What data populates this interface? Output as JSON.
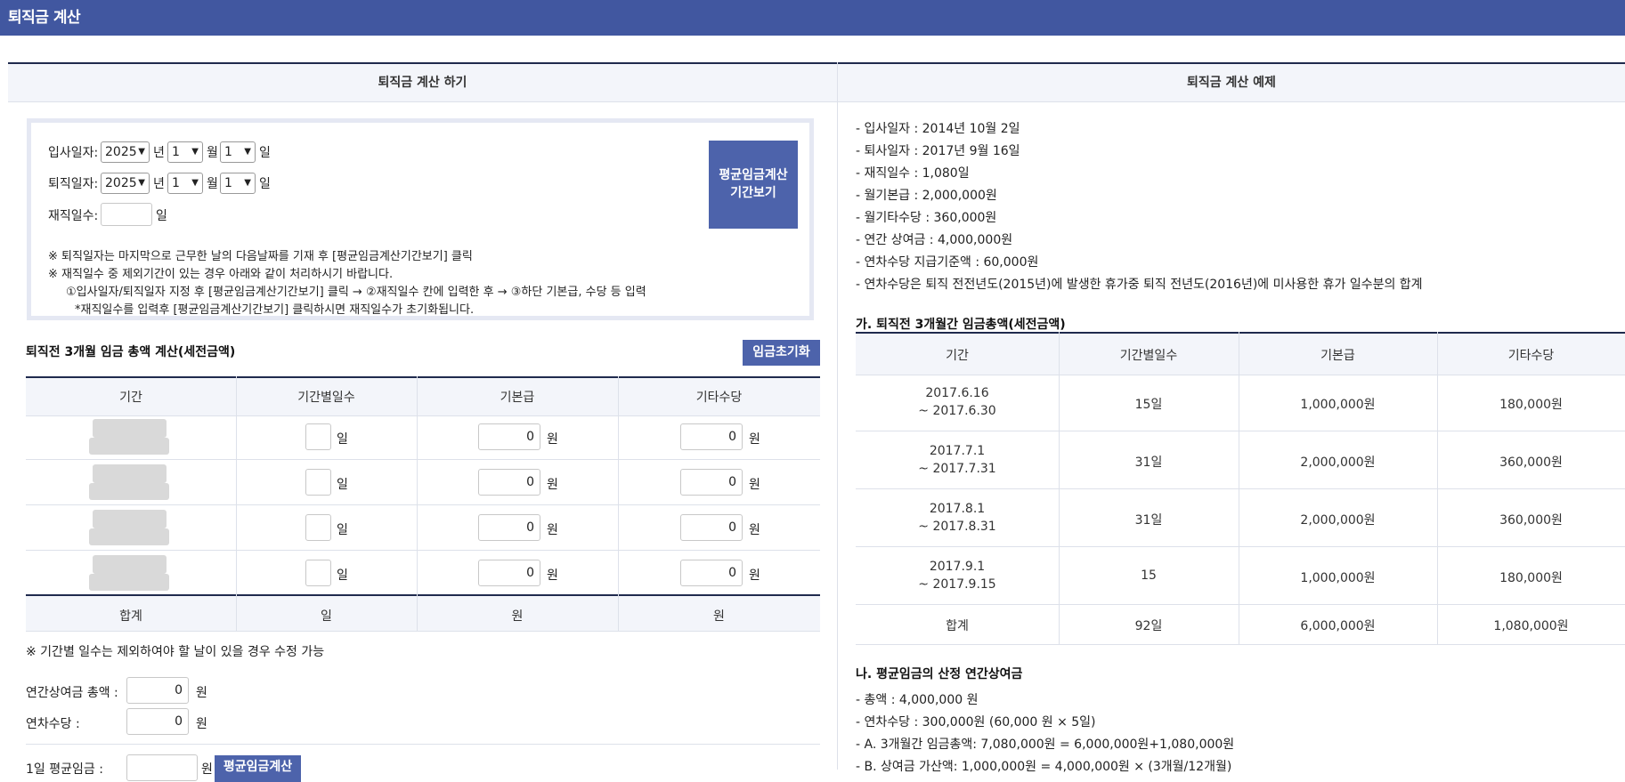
{
  "window": {
    "title": "퇴직금 계산"
  },
  "left": {
    "header": "퇴직금 계산 하기",
    "join_label": "입사일자:",
    "leave_label": "퇴직일자:",
    "days_label": "재직일수:",
    "year_value": "2025",
    "month_value": "1",
    "day_value": "1",
    "year_unit": "년",
    "month_unit": "월",
    "day_unit": "일",
    "avg_period_btn": [
      "평균임금계산",
      "기간보기"
    ],
    "notes": [
      "※ 퇴직일자는 마지막으로 근무한 날의 다음날짜를 기재 후 [평균임금계산기간보기] 클릭",
      "※ 재직일수 중 제외기간이 있는 경우 아래와 같이 처리하시기 바랍니다.",
      "①입사일자/퇴직일자 지정 후 [평균임금계산기간보기] 클릭 → ②재직일수 칸에 입력한 후 → ③하단 기본급, 수당 등 입력",
      "*재직일수를 입력후 [평균임금계산기간보기] 클릭하시면 재직일수가 초기화됩니다."
    ],
    "wage_title": "퇴직전 3개월 임금 총액 계산(세전금액)",
    "reset_btn": "임금초기화",
    "columns": [
      "기간",
      "기간별일수",
      "기본급",
      "기타수당"
    ],
    "row_value": "0",
    "won": "원",
    "day_unit2": "일",
    "sum_label": "합계",
    "period_note": "※ 기간별 일수는 제외하여야 할 날이 있을 경우 수정 가능",
    "bonus_label": "연간상여금 총액 :",
    "bonus_value": "0",
    "leave_pay_label": "연차수당 :",
    "leave_pay_value": "0",
    "daily_avg_label": "1일 평균임금 :",
    "calc_btn": "평균임금계산"
  },
  "right": {
    "header": "퇴직금 계산 예제",
    "info": [
      "- 입사일자 : 2014년 10월 2일",
      "- 퇴사일자 : 2017년 9월 16일",
      "- 재직일수 : 1,080일",
      "- 월기본급 : 2,000,000원",
      "- 월기타수당 : 360,000원",
      "- 연간 상여금 : 4,000,000원",
      "- 연차수당 지급기준액 : 60,000원",
      "- 연차수당은 퇴직 전전년도(2015년)에 발생한 휴가중 퇴직 전년도(2016년)에 미사용한 휴가 일수분의 합계"
    ],
    "section_a_title": "가. 퇴직전 3개월간 임금총액(세전금액)",
    "columns": [
      "기간",
      "기간별일수",
      "기본급",
      "기타수당"
    ],
    "rows": [
      {
        "period1": "2017.6.16",
        "period2": "~ 2017.6.30",
        "days": "15일",
        "base": "1,000,000원",
        "extra": "180,000원"
      },
      {
        "period1": "2017.7.1",
        "period2": "~ 2017.7.31",
        "days": "31일",
        "base": "2,000,000원",
        "extra": "360,000원"
      },
      {
        "period1": "2017.8.1",
        "period2": "~ 2017.8.31",
        "days": "31일",
        "base": "2,000,000원",
        "extra": "360,000원"
      },
      {
        "period1": "2017.9.1",
        "period2": "~ 2017.9.15",
        "days": "15",
        "base": "1,000,000원",
        "extra": "180,000원"
      }
    ],
    "total": {
      "label": "합계",
      "days": "92일",
      "base": "6,000,000원",
      "extra": "1,080,000원"
    },
    "section_b_title": "나. 평균임금의 산정 연간상여금",
    "section_b_lines": [
      "- 총액 : 4,000,000 원",
      "- 연차수당 : 300,000원 (60,000 원 × 5일)",
      "- A. 3개월간 임금총액: 7,080,000원 = 6,000,000원+1,080,000원",
      "- B. 상여금 가산액: 1,000,000원 = 4,000,000원 × (3개월/12개월)"
    ]
  }
}
